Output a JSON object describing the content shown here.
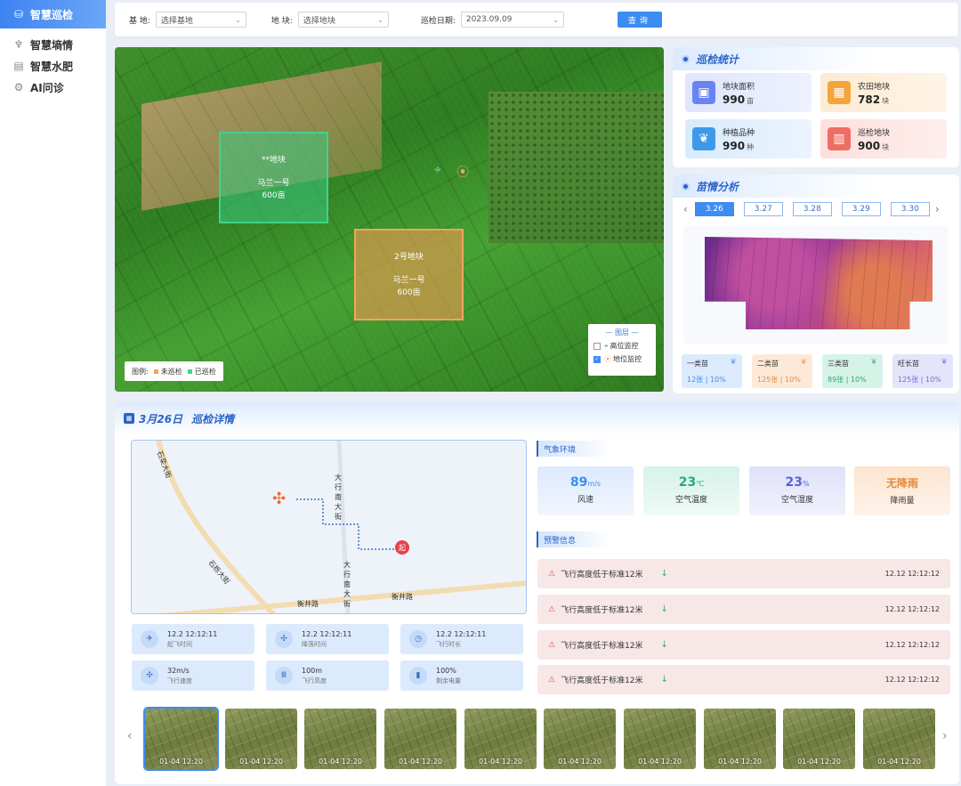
{
  "sidebar": {
    "items": [
      {
        "label": "智慧巡检",
        "icon": "patrol-icon",
        "active": true
      },
      {
        "label": "智慧墒情",
        "icon": "soil-icon",
        "active": false
      },
      {
        "label": "智慧水肥",
        "icon": "fertilizer-icon",
        "active": false
      },
      {
        "label": "AI问诊",
        "icon": "ai-icon",
        "active": false
      }
    ]
  },
  "filters": {
    "base_label": "基 地:",
    "base_value": "选择基地",
    "plot_label": "地 块:",
    "plot_value": "选择地块",
    "date_label": "巡检日期:",
    "date_value": "2023.09.09",
    "query_label": "查询"
  },
  "aerial": {
    "plots": [
      {
        "name": "**地块",
        "variety": "马兰一号",
        "area": "600亩"
      },
      {
        "name": "2号地块",
        "variety": "马兰一号",
        "area": "600亩"
      }
    ],
    "legend": {
      "title": "图例:",
      "pending": "未巡检",
      "done": "已巡检"
    },
    "layers": {
      "title": "— 图层 —",
      "items": [
        {
          "label": "高位监控",
          "checked": false
        },
        {
          "label": "地位监控",
          "checked": true
        }
      ]
    },
    "colors": {
      "pending": "#f3a35d",
      "done": "#3fd38a"
    }
  },
  "stats": {
    "title": "巡检统计",
    "cards": [
      {
        "label": "地块面积",
        "value": "990",
        "unit": "亩",
        "icon": "area-icon",
        "color": "#6a83f2"
      },
      {
        "label": "农田地块",
        "value": "782",
        "unit": "块",
        "icon": "field-icon",
        "color": "#f5a43c"
      },
      {
        "label": "种植品种",
        "value": "990",
        "unit": "种",
        "icon": "plant-icon",
        "color": "#3d9ae8"
      },
      {
        "label": "巡检地块",
        "value": "900",
        "unit": "块",
        "icon": "patrol-plot-icon",
        "color": "#ef6d62"
      }
    ]
  },
  "seedling": {
    "title": "苗情分析",
    "dates": [
      "3.26",
      "3.27",
      "3.28",
      "3.29",
      "3.30"
    ],
    "selected": 0,
    "grades": [
      {
        "name": "一类苗",
        "value": "12张 | 10%",
        "color": "#3d8cf2",
        "bg": "#dceafe"
      },
      {
        "name": "二类苗",
        "value": "125张 | 10%",
        "color": "#e58a3a",
        "bg": "#fde9d8"
      },
      {
        "name": "三类苗",
        "value": "89张 | 10%",
        "color": "#2aa876",
        "bg": "#d6f3e8"
      },
      {
        "name": "旺长苗",
        "value": "125张 | 10%",
        "color": "#6a6fd8",
        "bg": "#e4e4fb"
      }
    ]
  },
  "detail": {
    "date": "3月26日",
    "title": "巡检详情",
    "roads": [
      "石栾大街",
      "大行南大街",
      "石栎大街",
      "大行南大街",
      "衡井路",
      "衡井路"
    ],
    "start_marker": "起",
    "flight": [
      {
        "value": "12.2 12:12:11",
        "label": "起飞时间",
        "icon": "drone-icon"
      },
      {
        "value": "12.2 12:12:11",
        "label": "降落时间",
        "icon": "landing-icon"
      },
      {
        "value": "12.2 12:12:11",
        "label": "飞行时长",
        "icon": "clock-icon"
      },
      {
        "value": "32m/s",
        "label": "飞行速度",
        "icon": "speed-icon"
      },
      {
        "value": "100m",
        "label": "飞行高度",
        "icon": "height-icon"
      },
      {
        "value": "100%",
        "label": "剩余电量",
        "icon": "battery-icon"
      }
    ],
    "weather_title": "气象环境",
    "weather": [
      {
        "value": "89",
        "unit": "m/s",
        "label": "风速",
        "color": "#3d8cf2",
        "bg": "#dceafe"
      },
      {
        "value": "23",
        "unit": "℃",
        "label": "空气温度",
        "color": "#2aa876",
        "bg": "#daf3eb"
      },
      {
        "value": "23",
        "unit": "%",
        "label": "空气湿度",
        "color": "#5a63d0",
        "bg": "#e1e3fa"
      },
      {
        "value": "无降雨",
        "unit": "",
        "label": "降雨量",
        "color": "#e58a3a",
        "bg": "#fde9d8"
      }
    ],
    "alert_title": "预警信息",
    "alerts": [
      {
        "text": "飞行高度低于标准12米",
        "time": "12.12 12:12:12"
      },
      {
        "text": "飞行高度低于标准12米",
        "time": "12.12 12:12:12"
      },
      {
        "text": "飞行高度低于标准12米",
        "time": "12.12 12:12:12"
      },
      {
        "text": "飞行高度低于标准12米",
        "time": "12.12 12:12:12"
      }
    ],
    "thumbs": [
      "01-04 12:20",
      "01-04 12:20",
      "01-04 12:20",
      "01-04 12:20",
      "01-04 12:20",
      "01-04 12:20",
      "01-04 12:20",
      "01-04 12:20",
      "01-04 12:20",
      "01-04 12:20"
    ]
  }
}
